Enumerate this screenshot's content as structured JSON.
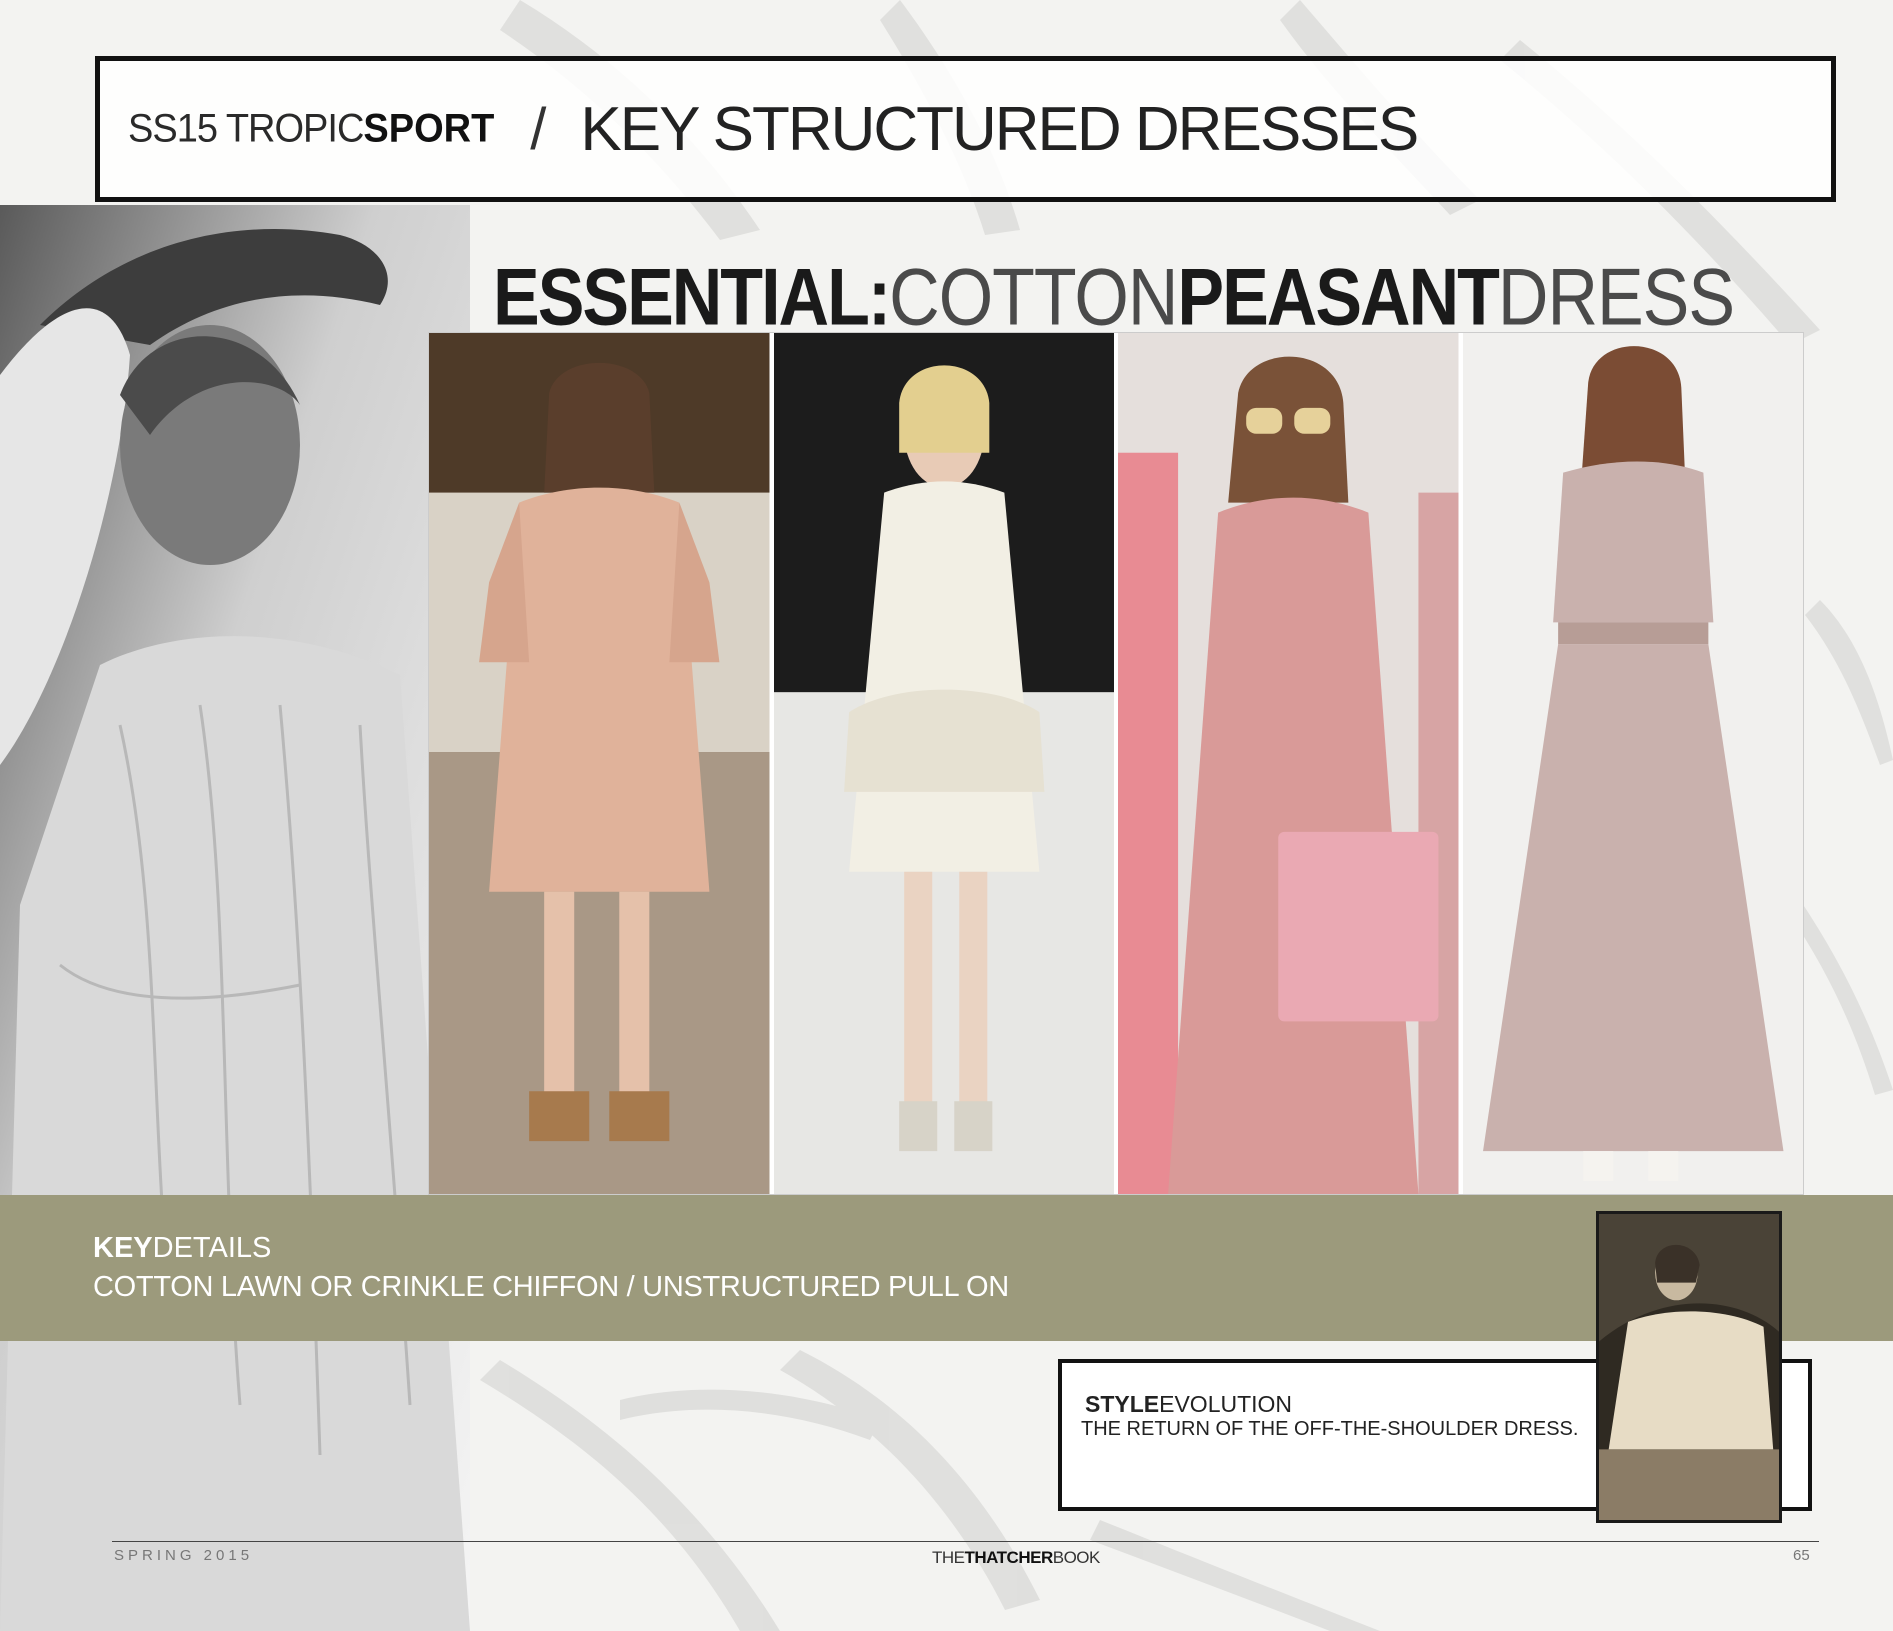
{
  "header": {
    "section_light": "SS15 TROPIC",
    "section_bold": "SPORT",
    "separator": "/",
    "title": "KEY STRUCTURED DRESSES"
  },
  "essential": {
    "part1_bold": "ESSENTIAL:",
    "part2_light": "COTTON",
    "part3_bold": "PEASANT",
    "part4_light": "DRESS"
  },
  "key_details": {
    "heading_bold": "KEY",
    "heading_light": "DETAILS",
    "details": "COTTON LAWN OR CRINKLE CHIFFON  /  UNSTRUCTURED PULL ON"
  },
  "style_evolution": {
    "heading_bold": "STYLE",
    "heading_light": "EVOLUTION",
    "description": "THE RETURN OF THE  OFF-THE-SHOULDER DRESS."
  },
  "footer": {
    "left": "SPRING 2015",
    "mid_light_1": "THE",
    "mid_bold": "THATCHER",
    "mid_light_2": "BOOK",
    "page_number": "65"
  },
  "colors": {
    "band": "#9c9a7c",
    "dress_peach": "#e0b29a",
    "dress_white": "#f2efe4",
    "dress_pink": "#d99a98",
    "dress_mauve": "#c9b1ad"
  },
  "photos": [
    "photo-model-peach-dress",
    "photo-model-white-dress",
    "photo-model-pink-dress",
    "photo-model-mauve-dress"
  ]
}
